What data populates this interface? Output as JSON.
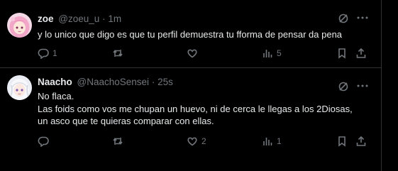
{
  "tweets": [
    {
      "display_name": "zoe",
      "handle": "@zoeu_u",
      "separator": "·",
      "time": "1m",
      "lines": [
        "y lo unico que digo es que tu perfil demuestra tu fforma de pensar da pena"
      ],
      "counts": {
        "replies": "1",
        "retweets": "",
        "likes": "",
        "views": "5"
      },
      "avatar_icon": "anime-girl-pink-hair-avatar"
    },
    {
      "display_name": "Naacho",
      "handle": "@NaachoSensei",
      "separator": "·",
      "time": "25s",
      "lines": [
        "No flaca.",
        "Las foids como vos me chupan un huevo, ni de cerca le llegas a los 2Diosas,",
        "un asco que te quieras comparar con ellas."
      ],
      "counts": {
        "replies": "",
        "retweets": "",
        "likes": "2",
        "views": "1"
      },
      "avatar_icon": "anime-girl-white-hair-avatar"
    }
  ],
  "colors": {
    "background": "#000000",
    "text": "#e7e9ea",
    "muted": "#71767b",
    "divider": "#2f3336"
  }
}
